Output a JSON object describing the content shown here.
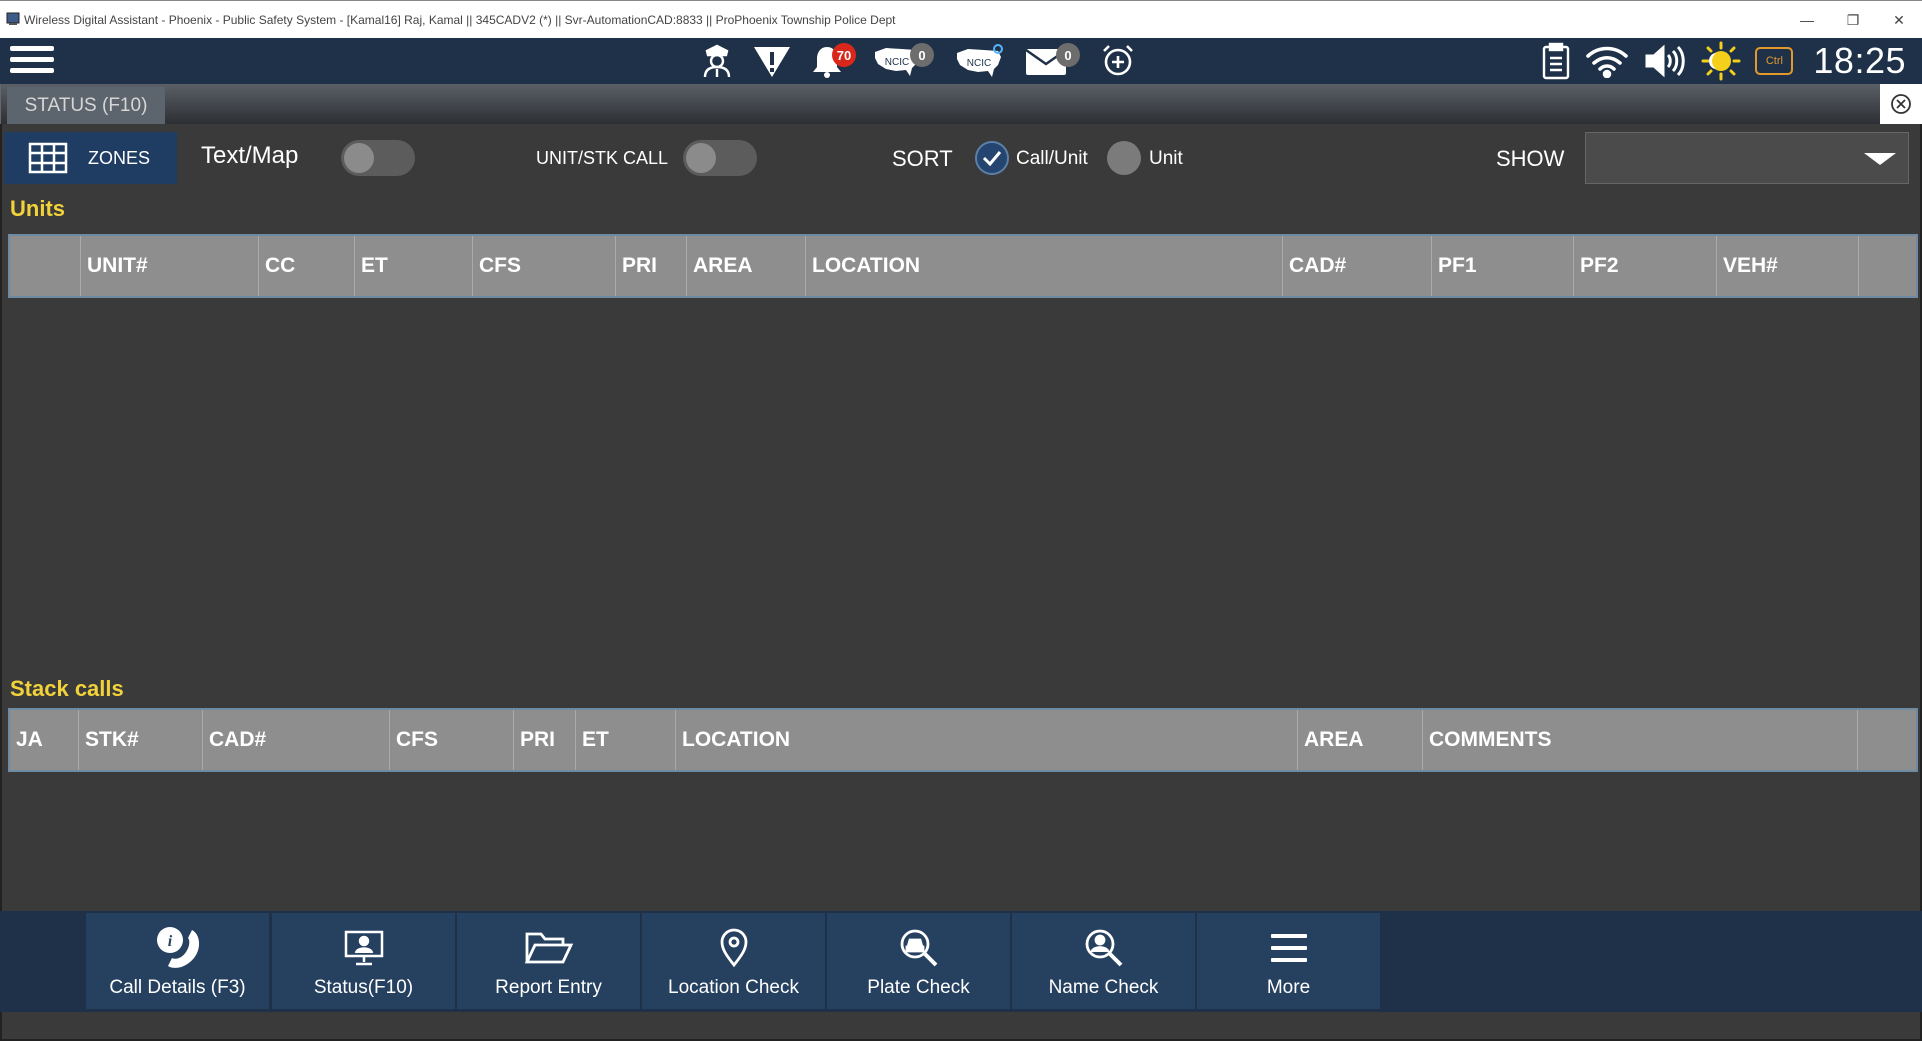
{
  "window": {
    "title": "Wireless Digital Assistant - Phoenix - Public Safety System - [Kamal16] Raj, Kamal || 345CADV2 (*) || Svr-AutomationCAD:8833 || ProPhoenix Township Police Dept",
    "minimize_glyph": "—",
    "restore_glyph": "❐",
    "close_glyph": "✕"
  },
  "topbar": {
    "alerts_count": "70",
    "ncic_count": "0",
    "ncic_label_1": "NCIC",
    "ncic_label_2": "NCIC",
    "messages_count": "0",
    "ctrl_label": "Ctrl",
    "clock": "18:25"
  },
  "tabs": {
    "status_tab": "STATUS (F10)"
  },
  "controls": {
    "zones_label": "ZONES",
    "textmap_label": "Text/Map",
    "unit_stk_call_label": "UNIT/STK CALL",
    "sort_label": "SORT",
    "sort_option_callunit": "Call/Unit",
    "sort_option_unit": "Unit",
    "show_label": "SHOW",
    "show_value": ""
  },
  "units": {
    "title": "Units",
    "columns": [
      "",
      "UNIT#",
      "CC",
      "ET",
      "CFS",
      "PRI",
      "AREA",
      "LOCATION",
      "CAD#",
      "PF1",
      "PF2",
      "VEH#",
      ""
    ]
  },
  "stack_calls": {
    "title": "Stack calls",
    "columns": [
      "JA",
      "STK#",
      "CAD#",
      "CFS",
      "PRI",
      "ET",
      "LOCATION",
      "AREA",
      "COMMENTS",
      ""
    ]
  },
  "bottom_toolbar": {
    "buttons": [
      "Call Details (F3)",
      "Status(F10)",
      "Report Entry",
      "Location Check",
      "Plate Check",
      "Name Check",
      "More"
    ]
  }
}
